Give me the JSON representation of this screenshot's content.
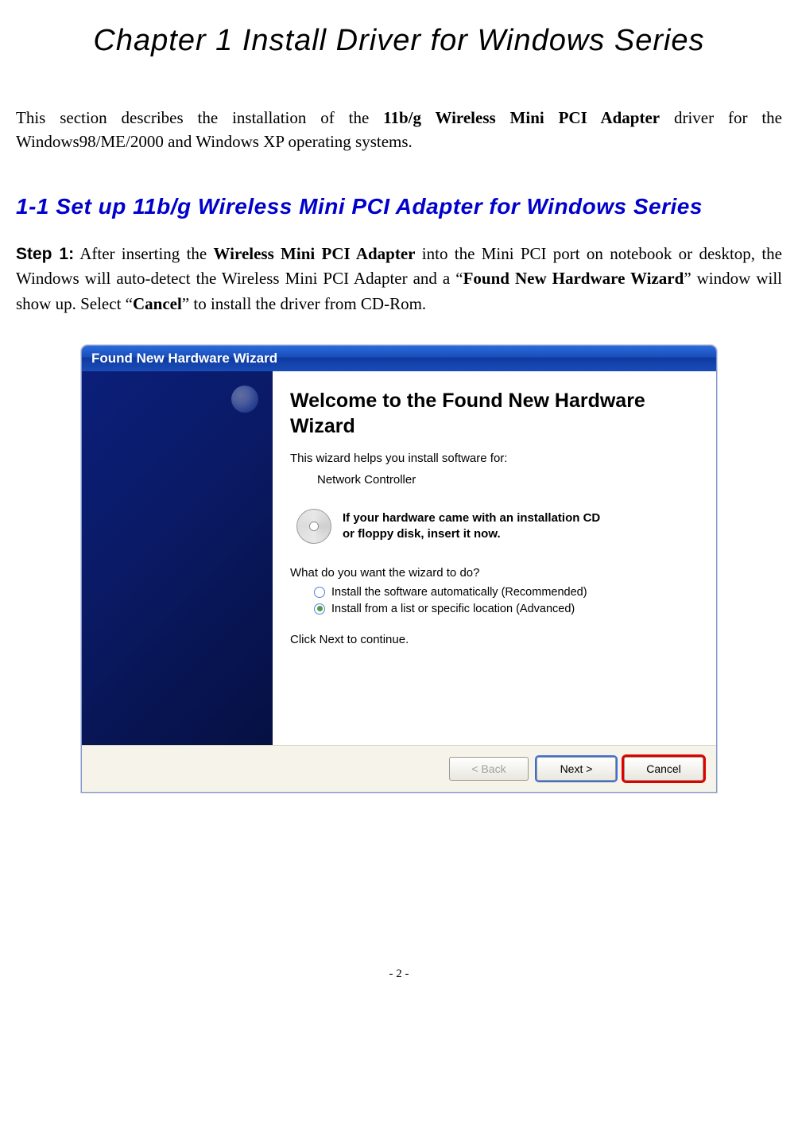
{
  "doc": {
    "chapter_title": "Chapter 1 Install Driver for Windows Series",
    "intro_pre": "This section describes the installation of the ",
    "intro_bold": "11b/g Wireless Mini PCI Adapter",
    "intro_post": " driver for the Windows98/ME/2000 and Windows XP operating systems.",
    "section_heading": "1-1 Set up 11b/g Wireless Mini PCI Adapter for Windows Series",
    "step_label": "Step 1:",
    "step_t1": " After inserting the ",
    "step_b1": "Wireless Mini PCI Adapter",
    "step_t2": " into the Mini PCI port on notebook or desktop, the Windows will auto-detect the Wireless Mini PCI Adapter and a “",
    "step_b2": "Found New Hardware Wizard",
    "step_t3": "” window will show up. Select “",
    "step_b3": "Cancel",
    "step_t4": "” to install the driver from CD-Rom.",
    "page_number": "- 2 -"
  },
  "wizard": {
    "title": "Found New Hardware Wizard",
    "heading": "Welcome to the Found New Hardware Wizard",
    "helps_text": "This wizard helps you install software for:",
    "device": "Network Controller",
    "cd_line1": "If your hardware came with an installation CD",
    "cd_line2": "or floppy disk, insert it now.",
    "prompt": "What do you want the wizard to do?",
    "option1": "Install the software automatically (Recommended)",
    "option2": "Install from a list or specific location (Advanced)",
    "selected_index": 1,
    "continue_text": "Click Next to continue.",
    "buttons": {
      "back": "< Back",
      "next": "Next >",
      "cancel": "Cancel"
    }
  }
}
